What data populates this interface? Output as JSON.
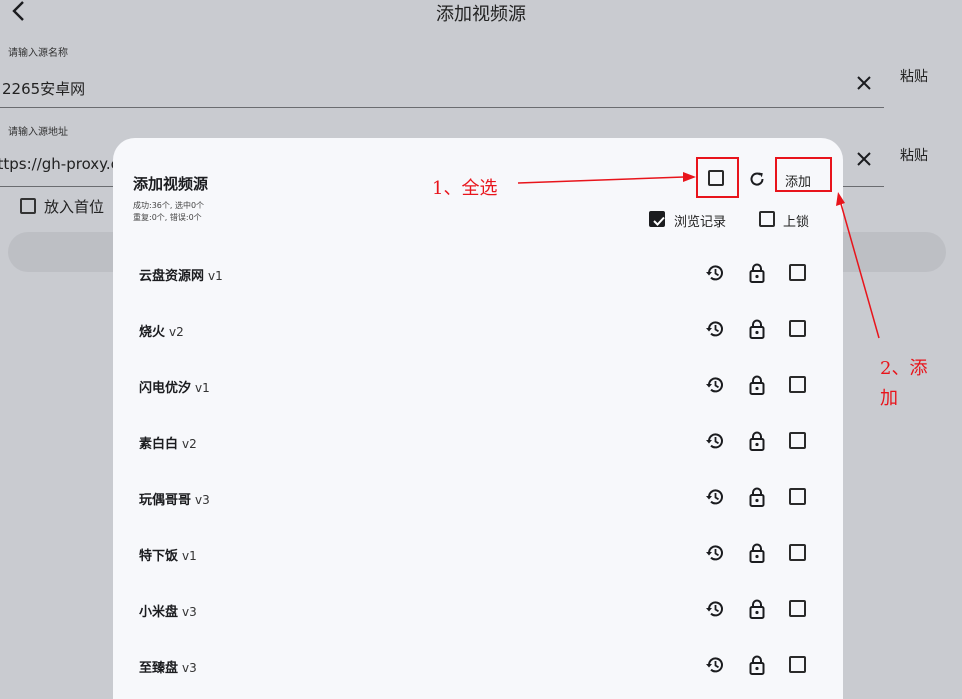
{
  "page": {
    "title": "添加视频源"
  },
  "form": {
    "name_label": "请输入源名称",
    "name_value": "2265安卓网",
    "url_label": "请输入源地址",
    "url_value": "https://gh-proxy.com/",
    "paste_label": "粘贴",
    "top_checkbox_label": "放入首位"
  },
  "dialog": {
    "title": "添加视频源",
    "stats_line1": "成功:36个, 选中0个",
    "stats_line2": "重复:0个, 错误:0个",
    "add_label": "添加",
    "history_label": "浏览记录",
    "history_checked": true,
    "lock_label": "上锁",
    "lock_checked": false,
    "rows": [
      {
        "name": "云盘资源网",
        "version": "v1"
      },
      {
        "name": "烧火",
        "version": "v2"
      },
      {
        "name": "闪电优汐",
        "version": "v1"
      },
      {
        "name": "素白白",
        "version": "v2"
      },
      {
        "name": "玩偶哥哥",
        "version": "v3"
      },
      {
        "name": "特下饭",
        "version": "v1"
      },
      {
        "name": "小米盘",
        "version": "v3"
      },
      {
        "name": "至臻盘",
        "version": "v3"
      }
    ]
  },
  "annotations": {
    "select_all": "1、全选",
    "add_line1": "2、添",
    "add_line2": "加",
    "color": "#e8141b"
  },
  "icons": {
    "back": "chevron-left-icon",
    "clear": "close-icon",
    "refresh": "refresh-icon",
    "history": "history-icon",
    "lock": "lock-icon"
  }
}
